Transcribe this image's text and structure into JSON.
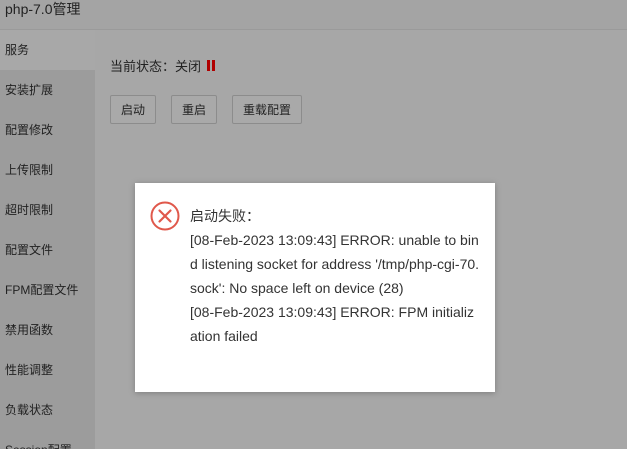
{
  "window": {
    "title": "php-7.0管理"
  },
  "sidebar": {
    "items": [
      {
        "label": "服务",
        "active": true
      },
      {
        "label": "安装扩展"
      },
      {
        "label": "配置修改"
      },
      {
        "label": "上传限制"
      },
      {
        "label": "超时限制"
      },
      {
        "label": "配置文件"
      },
      {
        "label": "FPM配置文件"
      },
      {
        "label": "禁用函数"
      },
      {
        "label": "性能调整"
      },
      {
        "label": "负载状态"
      },
      {
        "label": "Session配置"
      }
    ]
  },
  "main": {
    "status_label": "当前状态：",
    "status_value": "关闭",
    "buttons": {
      "start": "启动",
      "restart": "重启",
      "reload": "重载配置"
    }
  },
  "dialog": {
    "icon": "error-circle-x-icon",
    "heading": "启动失败：",
    "line1": "[08-Feb-2023 13:09:43] ERROR: unable to bind listening socket for address '/tmp/php-cgi-70.sock': No space left on device (28)",
    "line2": "[08-Feb-2023 13:09:43] ERROR: FPM initialization failed"
  },
  "colors": {
    "overlay": "#a7a7a7",
    "sidebar": "#9c9c9c",
    "error_icon": "#e0584b",
    "stopped": "#b00000",
    "dialog_bg": "#ffffff"
  }
}
